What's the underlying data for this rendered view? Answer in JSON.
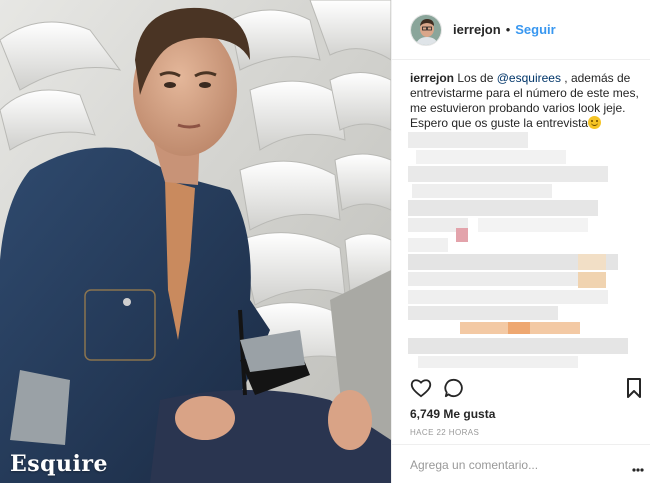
{
  "photo": {
    "alt_role": "post-photo",
    "brand_text": "Esquire"
  },
  "header": {
    "username": "ierrejon",
    "separator": "•",
    "follow_label": "Seguir"
  },
  "caption": {
    "username": "ierrejon",
    "text_before": "Los de ",
    "mention": "@esquirees",
    "text_after": " , además de entrevistarme para el número de este mes, me estuvieron probando varios look jeje. Espero que os guste la entrevista"
  },
  "actions": {
    "like_icon": "heart-icon",
    "comment_icon": "comment-icon",
    "save_icon": "bookmark-icon"
  },
  "likes_text": "6,749 Me gusta",
  "timestamp": "HACE 22 HORAS",
  "comment_placeholder": "Agrega un comentario...",
  "more_icon": "more-dots-icon",
  "colors": {
    "link": "#3897f0",
    "text": "#262626",
    "muted": "#999999",
    "divider": "#efefef"
  }
}
